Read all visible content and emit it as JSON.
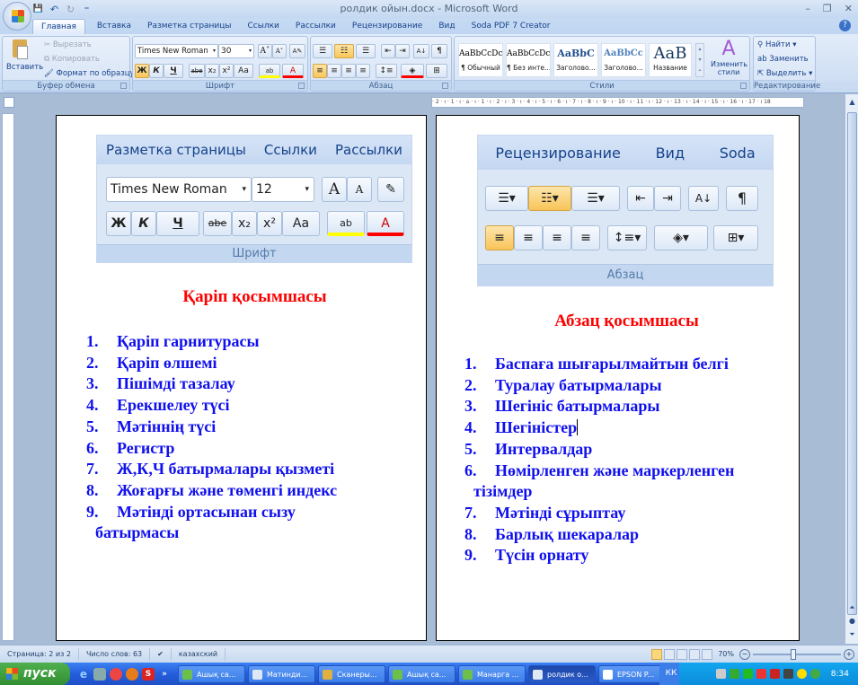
{
  "window": {
    "title": "ролдик ойын.docx - Microsoft Word",
    "minimize": "–",
    "restore": "❐",
    "close": "✕"
  },
  "qat": {
    "save": "💾",
    "undo": "↶",
    "redo": "↻",
    "customize": "⁼"
  },
  "tabs": [
    "Главная",
    "Вставка",
    "Разметка страницы",
    "Ссылки",
    "Рассылки",
    "Рецензирование",
    "Вид",
    "Soda PDF 7 Creator"
  ],
  "active_tab": "Главная",
  "ribbon": {
    "clipboard": {
      "label": "Буфер обмена",
      "paste": "Вставить",
      "cut": "Вырезать",
      "copy": "Копировать",
      "format_painter": "Формат по образцу"
    },
    "font": {
      "label": "Шрифт",
      "font_name": "Times New Roman",
      "font_size": "30",
      "grow": "A˄",
      "shrink": "A˅",
      "clear": "A✎",
      "bold": "Ж",
      "italic": "К",
      "underline": "Ч",
      "strike": "abe",
      "subscript": "x₂",
      "superscript": "x²",
      "case": "Aa",
      "highlight": "ab",
      "color": "A"
    },
    "paragraph": {
      "label": "Абзац",
      "bullets": "☰",
      "numbering": "☷",
      "multilevel": "☰",
      "dec_indent": "⇤",
      "inc_indent": "⇥",
      "sort": "A↓",
      "pilcrow": "¶",
      "align_left": "≡",
      "center": "≡",
      "align_right": "≡",
      "justify": "≡",
      "spacing": "↕≡",
      "shading": "◈",
      "borders": "⊞"
    },
    "styles": {
      "label": "Стили",
      "items": [
        {
          "sample": "AaBbCcDc",
          "name": "¶ Обычный"
        },
        {
          "sample": "AaBbCcDc",
          "name": "¶ Без инте..."
        },
        {
          "sample": "AaBbC",
          "name": "Заголово..."
        },
        {
          "sample": "AaBbCc",
          "name": "Заголово..."
        },
        {
          "sample": "AaB",
          "name": "Название"
        }
      ],
      "change_styles": "Изменить стили"
    },
    "editing": {
      "label": "Редактирование",
      "find": "Найти",
      "replace": "Заменить",
      "select": "Выделить"
    }
  },
  "ruler_text": "· 2 · ı · 1 · ı · ⌂ · ı · 1 · ı · 2 · ı · 3 · ı · 4 · ı · 5 · ı · 6 · ı · 7 · ı · 8 · ı · 9 · ı · 10 · ı · 11 · ı · 12 · ı · 13 · ı · 14 · ı · 15 · ı · 16 · ı · 17 · ı 18",
  "page1": {
    "image": {
      "tabs": [
        "Разметка страницы",
        "Ссылки",
        "Рассылки"
      ],
      "font_name": "Times New Roman",
      "font_size": "12",
      "grow": "A",
      "shrink": "A",
      "bold": "Ж",
      "italic": "К",
      "underline": "Ч",
      "strike": "abe",
      "sub": "x₂",
      "sup": "x²",
      "case": "Aa",
      "highlight": "ab",
      "color": "A",
      "label": "Шрифт"
    },
    "title": "Қаріп қосымшасы",
    "items": [
      {
        "num": "1.",
        "text": "Қаріп гарнитурасы"
      },
      {
        "num": "2.",
        "text": "Қаріп өлшемі"
      },
      {
        "num": "3.",
        "text": "Пішімді тазалау"
      },
      {
        "num": "4.",
        "text": "Ерекшелеу түсі"
      },
      {
        "num": "5.",
        "text": "Мәтіннің түсі"
      },
      {
        "num": "6.",
        "text": "Регистр"
      },
      {
        "num": "7.",
        "text": "Ж,К,Ч батырмалары қызметі"
      },
      {
        "num": "8.",
        "text": "Жоғарғы және төменгі индекс"
      },
      {
        "num": "9.",
        "text": "Мәтінді ортасынан сызу",
        "cont": "батырмасы"
      }
    ]
  },
  "page2": {
    "image": {
      "tabs": [
        "Рецензирование",
        "Вид",
        "Soda"
      ],
      "label": "Абзац",
      "sort": "A↓",
      "pilcrow": "¶"
    },
    "title": "Абзац қосымшасы",
    "items": [
      {
        "num": "1.",
        "text": "Баспаға шығарылмайтын белгі"
      },
      {
        "num": "2.",
        "text": "Туралау батырмалары"
      },
      {
        "num": "3.",
        "text": "Шегініс батырмалары"
      },
      {
        "num": "4.",
        "text": "Шегіністер"
      },
      {
        "num": "5.",
        "text": "Интервалдар"
      },
      {
        "num": "6.",
        "text": "Нөмірленген және маркерленген",
        "cont": "тізімдер"
      },
      {
        "num": "7.",
        "text": "Мәтінді сұрыптау"
      },
      {
        "num": "8.",
        "text": "Барлық шекаралар"
      },
      {
        "num": "9.",
        "text": "Түсін орнату"
      }
    ]
  },
  "status": {
    "page": "Страница: 2 из 2",
    "words": "Число слов: 63",
    "language": "казахский",
    "zoom": "70%"
  },
  "taskbar": {
    "start": "пуск",
    "more": "»",
    "tasks": [
      {
        "label": "Ашық са...",
        "color": "#6cc04a"
      },
      {
        "label": "Матинди...",
        "color": "#dfe8f5"
      },
      {
        "label": "Сканеры...",
        "color": "#e0b040"
      },
      {
        "label": "Ашық са...",
        "color": "#6cc04a"
      },
      {
        "label": "Манарга ...",
        "color": "#6cc04a"
      },
      {
        "label": "ролдик о...",
        "color": "#dfe8f5",
        "active": true
      },
      {
        "label": "EPSON P...",
        "color": "#ffffff"
      }
    ],
    "lang": "КК",
    "clock": "8:34"
  }
}
